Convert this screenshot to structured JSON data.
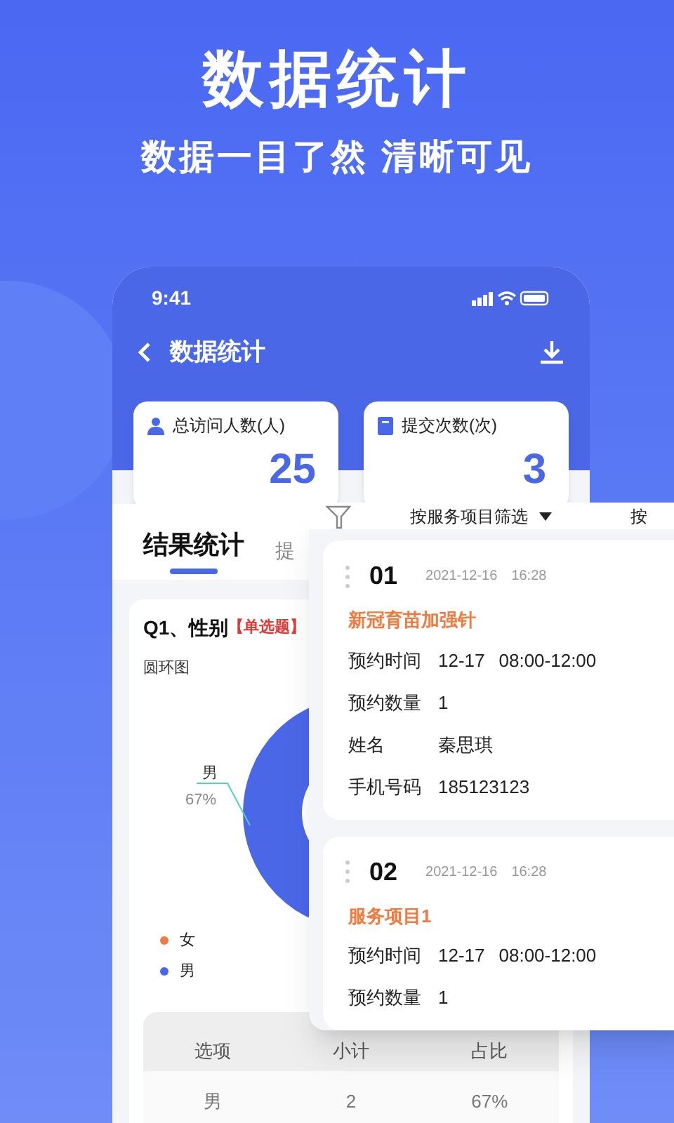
{
  "headline": {
    "title": "数据统计",
    "subtitle": "数据一目了然 清晰可见"
  },
  "status_bar": {
    "time": "9:41"
  },
  "nav": {
    "title": "数据统计"
  },
  "stats": [
    {
      "label": "总访问人数(人)",
      "value": "25",
      "kind": "person"
    },
    {
      "label": "提交次数(次)",
      "value": "3",
      "kind": "document"
    }
  ],
  "tabs": [
    {
      "label": "结果统计",
      "selected": true
    },
    {
      "label": "提",
      "selected": false
    }
  ],
  "question": {
    "title": "Q1、性别",
    "tag": "【单选题】",
    "chart_label": "圆环图",
    "callout": {
      "label": "男",
      "percent": "67%"
    },
    "legend": [
      {
        "label": "女",
        "color": "#f07b3f"
      },
      {
        "label": "男",
        "color": "#4a67e8"
      }
    ]
  },
  "table": {
    "columns": [
      "选项",
      "小计",
      "占比"
    ],
    "rows": [
      [
        "男",
        "2",
        "67%"
      ]
    ]
  },
  "filter_bar": {
    "items": [
      "按服务项目筛选",
      "按"
    ]
  },
  "records": [
    {
      "number": "01",
      "date": "2021-12-16",
      "time": "16:28",
      "service": "新冠育苗加强针",
      "fields": [
        {
          "label": "预约时间",
          "values": [
            "12-17",
            "08:00-12:00"
          ]
        },
        {
          "label": "预约数量",
          "values": [
            "1"
          ]
        },
        {
          "label": "姓名",
          "values": [
            "秦思琪"
          ]
        },
        {
          "label": "手机号码",
          "values": [
            "185123123"
          ]
        }
      ]
    },
    {
      "number": "02",
      "date": "2021-12-16",
      "time": "16:28",
      "service": "服务项目1",
      "fields": [
        {
          "label": "预约时间",
          "values": [
            "12-17",
            "08:00-12:00"
          ]
        },
        {
          "label": "预约数量",
          "values": [
            "1"
          ]
        }
      ]
    }
  ]
}
